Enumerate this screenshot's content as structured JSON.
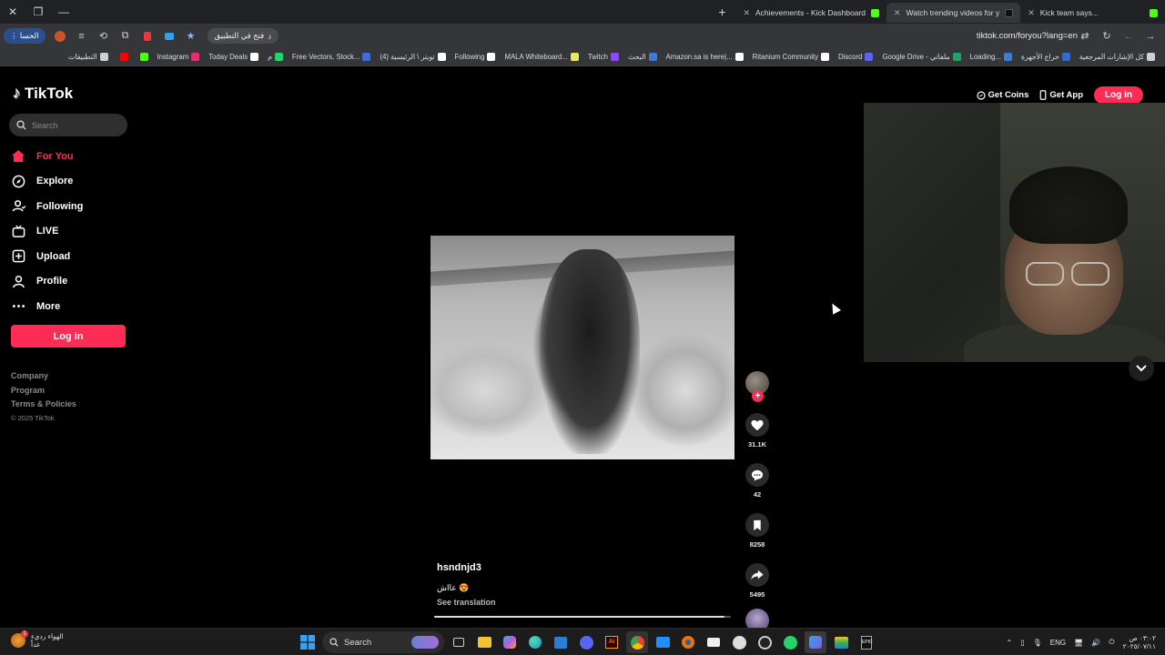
{
  "browser": {
    "tabs": [
      {
        "title": "Achievements - Kick Dashboard",
        "favicon_color": "#53fc18",
        "active": false
      },
      {
        "title": "Watch trending videos for y",
        "favicon_color": "#000000",
        "active": true
      },
      {
        "title": "Kick team says...",
        "favicon_color": "#53fc18",
        "active": false
      }
    ],
    "profile_label": "الحسا",
    "open_in_app": "فتح في التطبيق",
    "url": "tiktok.com/foryou?lang=en",
    "bookmarks": [
      {
        "label": "كل الإشارات المرجعية",
        "color": "#cfcfcf"
      },
      {
        "label": "حراج الأجهزة",
        "color": "#2b6fd6"
      },
      {
        "label": "Loading...",
        "color": "#3b7bd9"
      },
      {
        "label": "Google Drive - ملفاتي",
        "color": "#1fa463"
      },
      {
        "label": "Discord",
        "color": "#5865f2"
      },
      {
        "label": "Ritanium Community",
        "color": "#ffffff"
      },
      {
        "label": "Amazon.sa is here|...",
        "color": "#ffffff"
      },
      {
        "label": "البحث",
        "color": "#3b7bd9"
      },
      {
        "label": "Twitch",
        "color": "#9146ff"
      },
      {
        "label": "MALA Whiteboard...",
        "color": "#e8e85a"
      },
      {
        "label": "Following",
        "color": "#ffffff"
      },
      {
        "label": "(4) تويتر \\ الرئيسية",
        "color": "#ffffff"
      },
      {
        "label": "Free Vectors, Stock...",
        "color": "#3b6fd6"
      },
      {
        "label": "م",
        "color": "#25d366"
      },
      {
        "label": "Today Deals",
        "color": "#ffffff"
      },
      {
        "label": "Instagram",
        "color": "#e1306c"
      },
      {
        "label": "",
        "color": "#53fc18"
      },
      {
        "label": "",
        "color": "#ff0000"
      },
      {
        "label": "التطبيقات",
        "color": "#cfcfcf"
      }
    ]
  },
  "tiktok": {
    "logo": "TikTok",
    "search_placeholder": "Search",
    "nav": [
      {
        "label": "For You",
        "icon": "home-icon",
        "active": true
      },
      {
        "label": "Explore",
        "icon": "compass-icon",
        "active": false
      },
      {
        "label": "Following",
        "icon": "user-follow-icon",
        "active": false
      },
      {
        "label": "LIVE",
        "icon": "live-tv-icon",
        "active": false
      },
      {
        "label": "Upload",
        "icon": "upload-icon",
        "active": false
      },
      {
        "label": "Profile",
        "icon": "profile-icon",
        "active": false
      },
      {
        "label": "More",
        "icon": "more-icon",
        "active": false
      }
    ],
    "login_button": "Log in",
    "footer": {
      "company": "Company",
      "program": "Program",
      "terms": "Terms & Policies",
      "copyright": "© 2025 TikTok"
    },
    "top_right": {
      "get_coins": "Get Coins",
      "get_app": "Get App",
      "login": "Log in"
    },
    "video": {
      "username": "hsndnjd3",
      "caption": "عااش 😍",
      "see_translation": "See translation",
      "likes": "31.1K",
      "comments": "42",
      "saves": "8258",
      "shares": "5495",
      "progress": 0.98
    },
    "accent_color": "#fe2c55"
  },
  "taskbar": {
    "weather_line1": "الهواء رديء",
    "weather_line2": "غداً",
    "weather_badge": "1",
    "search_label": "Search",
    "language": "ENG",
    "time": "٠٣:٠٢ ص",
    "date": "٢٠٢٥/٠٧/١١"
  }
}
